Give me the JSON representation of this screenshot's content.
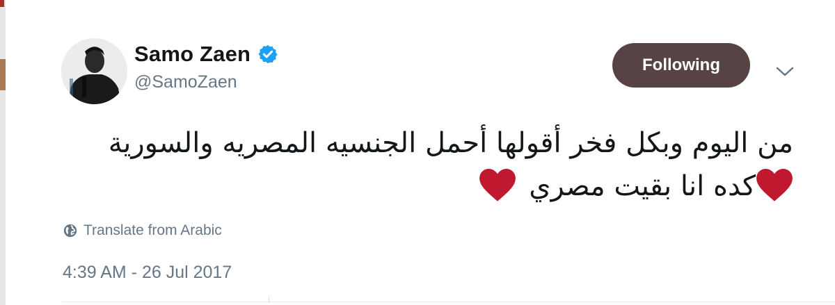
{
  "user": {
    "display_name": "Samo Zaen",
    "handle": "@SamoZaen",
    "verified": true
  },
  "follow_button": {
    "label": "Following"
  },
  "menu": {
    "icon": "chevron-down-icon"
  },
  "tweet": {
    "line1": "من اليوم وبكل فخر أقولها أحمل الجنسيه المصريه والسورية",
    "line2": "كده انا بقيت مصري"
  },
  "translate": {
    "label": "Translate from Arabic",
    "icon": "globe-icon"
  },
  "timestamp": "4:39 AM - 26 Jul 2017",
  "colors": {
    "follow_button_bg": "#574343",
    "verified_badge": "#1da1f2",
    "heart": "#c0182f",
    "secondary_text": "#657786"
  }
}
